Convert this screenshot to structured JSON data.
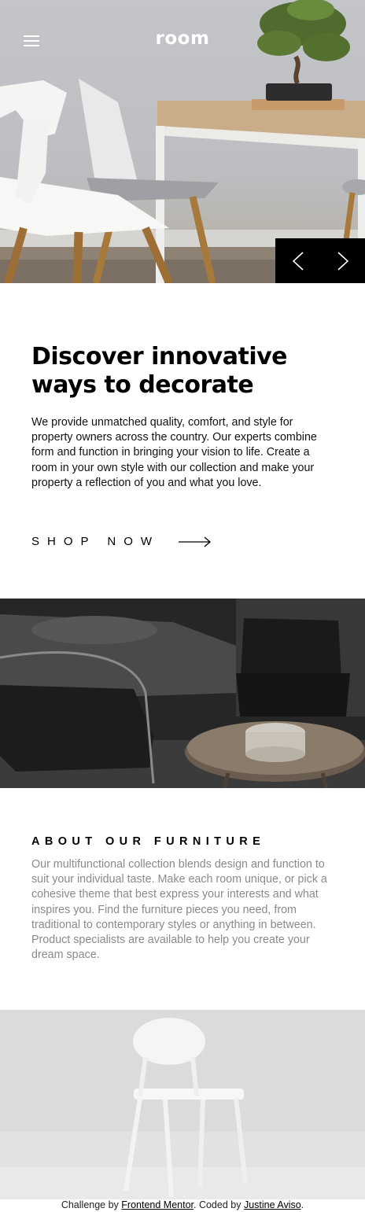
{
  "header": {
    "logo": "room",
    "menu_icon": "hamburger-menu-icon"
  },
  "hero": {
    "image_alt": "white chairs and wooden table with bonsai",
    "prev_icon": "chevron-left-icon",
    "next_icon": "chevron-right-icon"
  },
  "intro": {
    "title": "Discover innovative ways to decorate",
    "body": "We provide unmatched quality, comfort, and style for property owners across the country. Our experts combine form and function in bringing your vision to life. Create a room in your own style with our collection and make your property a reflection of you and what you love.",
    "cta_label": "SHOP NOW",
    "cta_icon": "arrow-right-icon"
  },
  "about": {
    "title": "ABOUT OUR FURNITURE",
    "body": "Our multifunctional collection blends design and function to suit your individual taste. Make each room unique, or pick a cohesive theme that best express your interests and what inspires you. Find the furniture pieces you need, from traditional to contemporary styles or anything in between. Product specialists are available to help you create your dream space."
  },
  "footer": {
    "prefix": "Challenge by ",
    "link1": "Frontend Mentor",
    "middle": ". Coded by ",
    "link2": "Justine Aviso",
    "suffix": "."
  },
  "colors": {
    "text": "#000000",
    "muted_text": "#8a8a8a",
    "controls_bg": "#000000",
    "page_bg": "#ffffff"
  }
}
